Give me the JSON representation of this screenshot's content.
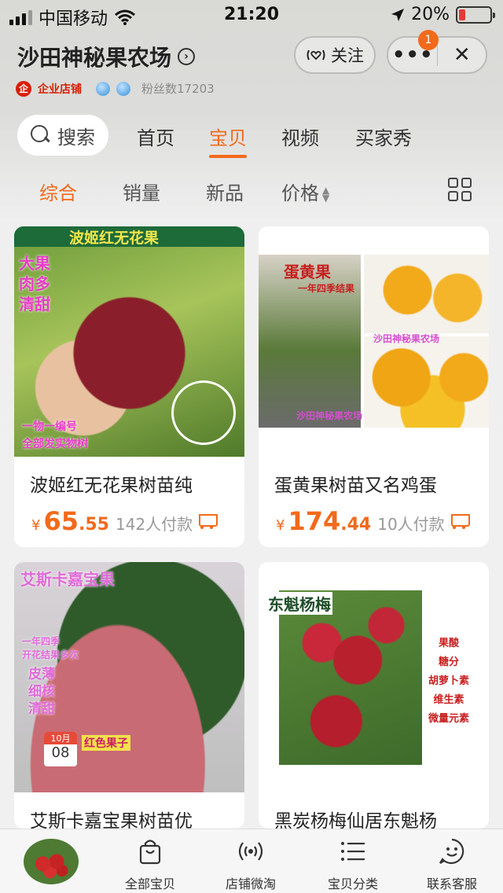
{
  "status_bar": {
    "carrier": "中国移动",
    "time": "21:20",
    "battery": "20%",
    "battery_level": 0.2,
    "icons": [
      "signal-icon",
      "wifi-icon",
      "location-arrow-icon",
      "battery-icon"
    ]
  },
  "shop": {
    "name": "沙田神秘果农场",
    "follow_label": "关注",
    "badge_count": "1",
    "enterprise_label": "企业店铺",
    "fans_label": "粉丝数17203"
  },
  "nav": {
    "search_label": "搜索",
    "tabs": [
      {
        "label": "首页",
        "active": false
      },
      {
        "label": "宝贝",
        "active": true
      },
      {
        "label": "视频",
        "active": false
      },
      {
        "label": "买家秀",
        "active": false
      }
    ]
  },
  "sort": {
    "items": [
      "综合",
      "销量",
      "新品",
      "价格"
    ],
    "active": "综合"
  },
  "products": [
    {
      "title": "波姬红无花果树苗纯",
      "price_int": "65",
      "price_dec": ".55",
      "sold": "142人付款",
      "img_banner": "波姬红无花果",
      "img_side": "大果\n肉多\n清甜",
      "img_bottom1": "一物一编号",
      "img_bottom2": "全部发实物树"
    },
    {
      "title": "蛋黄果树苗又名鸡蛋",
      "price_int": "174",
      "price_dec": ".44",
      "sold": "10人付款",
      "img_banner": "蛋黄果",
      "img_sub": "一年四季结果",
      "img_farm1": "沙田神秘果农场",
      "img_farm2": "沙田神秘果农场"
    },
    {
      "title": "艾斯卡嘉宝果树苗优",
      "price_int": "",
      "price_dec": "",
      "sold": "",
      "img_banner": "艾斯卡嘉宝果",
      "img_sub": "一年四季\n开花结果多次",
      "img_side": "皮薄\n细核\n清甜",
      "img_tag": "红色果子",
      "img_month": "10月",
      "img_day": "08"
    },
    {
      "title": "黑炭杨梅仙居东魁杨",
      "price_int": "",
      "price_dec": "",
      "sold": "",
      "img_banner": "东魁杨梅",
      "img_side": "果酸\n糖分\n胡萝卜素\n维生素\n微量元素"
    }
  ],
  "bottom_nav": {
    "items": [
      {
        "label": "全部宝贝",
        "icon": "shopping-bag-icon"
      },
      {
        "label": "店铺微淘",
        "icon": "broadcast-icon"
      },
      {
        "label": "宝贝分类",
        "icon": "list-icon"
      },
      {
        "label": "联系客服",
        "icon": "chat-smile-icon"
      }
    ]
  },
  "colors": {
    "accent": "#f26a1b",
    "enterprise": "#d81e06"
  }
}
